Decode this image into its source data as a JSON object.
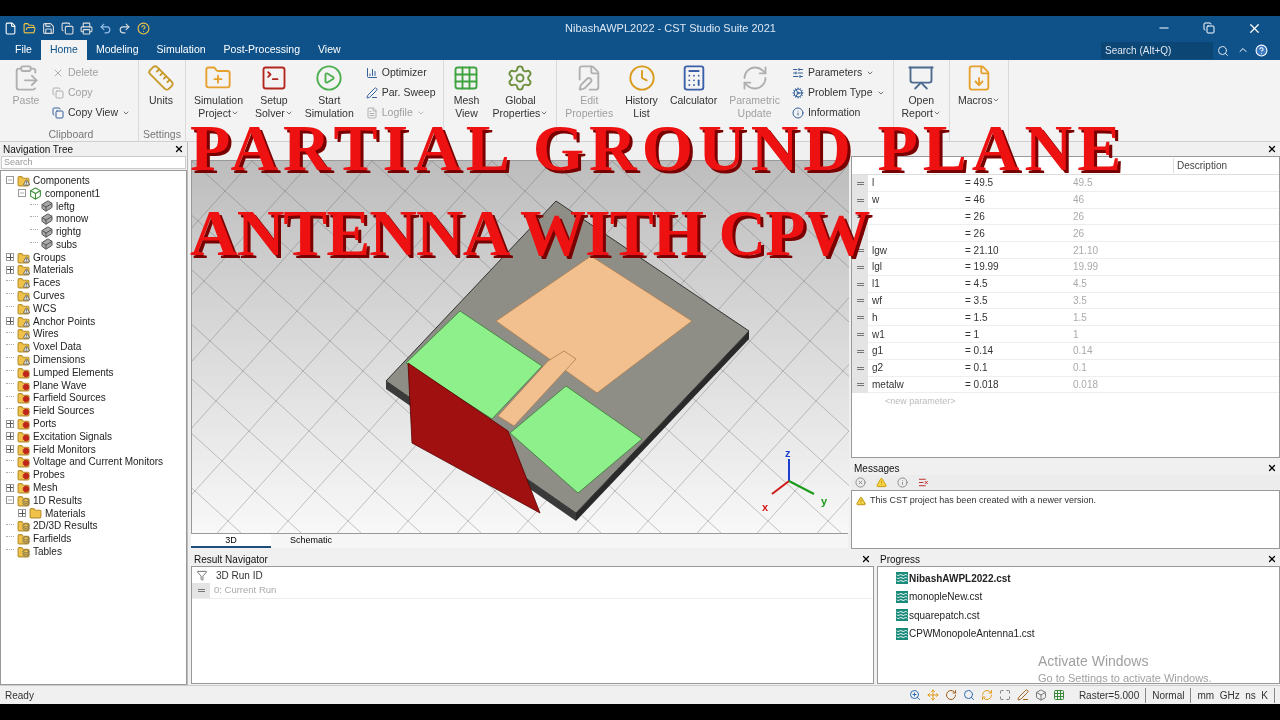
{
  "window": {
    "title": "NibashAWPL2022 - CST Studio Suite 2021"
  },
  "menu": [
    {
      "label": "File",
      "selected": false
    },
    {
      "label": "Home",
      "selected": true
    },
    {
      "label": "Modeling",
      "selected": false
    },
    {
      "label": "Simulation",
      "selected": false
    },
    {
      "label": "Post-Processing",
      "selected": false
    },
    {
      "label": "View",
      "selected": false
    }
  ],
  "search": {
    "placeholder": "Search (Alt+Q)"
  },
  "ribbon": [
    {
      "label": "Clipboard",
      "items": [
        {
          "kind": "large",
          "lines": [
            "Paste"
          ],
          "disabled": true,
          "dropdown": false
        },
        {
          "kind": "stack",
          "items": [
            {
              "label": "Delete",
              "disabled": true,
              "dropdown": false
            },
            {
              "label": "Copy",
              "disabled": true,
              "dropdown": false
            },
            {
              "label": "Copy View",
              "disabled": false,
              "dropdown": true
            }
          ]
        }
      ]
    },
    {
      "label": "Settings",
      "items": [
        {
          "kind": "large",
          "lines": [
            "Units"
          ],
          "disabled": false,
          "dropdown": false
        }
      ]
    },
    {
      "items": [
        {
          "kind": "large",
          "lines": [
            "Simulation",
            "Project"
          ],
          "disabled": false,
          "dropdown": true
        },
        {
          "kind": "large",
          "lines": [
            "Setup",
            "Solver"
          ],
          "disabled": false,
          "dropdown": true
        },
        {
          "kind": "large",
          "lines": [
            "Start",
            "Simulation"
          ],
          "disabled": false,
          "dropdown": false
        },
        {
          "kind": "stack",
          "items": [
            {
              "label": "Optimizer",
              "disabled": false,
              "dropdown": false
            },
            {
              "label": "Par. Sweep",
              "disabled": false,
              "dropdown": false
            },
            {
              "label": "Logfile",
              "disabled": true,
              "dropdown": true
            }
          ]
        }
      ]
    },
    {
      "items": [
        {
          "kind": "large",
          "lines": [
            "Mesh",
            "View"
          ],
          "disabled": false,
          "dropdown": false
        },
        {
          "kind": "large",
          "lines": [
            "Global",
            "Properties"
          ],
          "disabled": false,
          "dropdown": true
        }
      ]
    },
    {
      "items": [
        {
          "kind": "large",
          "lines": [
            "Edit",
            "Properties"
          ],
          "disabled": true,
          "dropdown": false
        },
        {
          "kind": "large",
          "lines": [
            "History",
            "List"
          ],
          "disabled": false,
          "dropdown": false
        },
        {
          "kind": "large",
          "lines": [
            "Calculator"
          ],
          "disabled": false,
          "dropdown": false
        },
        {
          "kind": "large",
          "lines": [
            "Parametric",
            "Update"
          ],
          "disabled": true,
          "dropdown": false
        },
        {
          "kind": "stack",
          "items": [
            {
              "label": "Parameters",
              "disabled": false,
              "dropdown": true
            },
            {
              "label": "Problem Type",
              "disabled": false,
              "dropdown": true
            },
            {
              "label": "Information",
              "disabled": false,
              "dropdown": false
            }
          ]
        }
      ]
    },
    {
      "items": [
        {
          "kind": "large",
          "lines": [
            "Open",
            "Report"
          ],
          "disabled": false,
          "dropdown": true
        }
      ]
    },
    {
      "items": [
        {
          "kind": "large",
          "lines": [
            "Macros"
          ],
          "disabled": false,
          "dropdown": true
        }
      ]
    }
  ],
  "navigation_tree": {
    "title": "Navigation Tree",
    "search": {
      "placeholder": "Search"
    },
    "items": [
      {
        "label": "Components",
        "kind": "folder-warn",
        "expandable": true,
        "expanded": true,
        "children": [
          {
            "label": "component1",
            "kind": "component",
            "expandable": true,
            "expanded": true,
            "children": [
              {
                "label": "leftg",
                "kind": "solid"
              },
              {
                "label": "monow",
                "kind": "solid"
              },
              {
                "label": "rightg",
                "kind": "solid"
              },
              {
                "label": "subs",
                "kind": "solid"
              }
            ]
          }
        ]
      },
      {
        "label": "Groups",
        "kind": "folder-warn",
        "expandable": true,
        "expanded": false
      },
      {
        "label": "Materials",
        "kind": "folder-warn",
        "expandable": true,
        "expanded": false
      },
      {
        "label": "Faces",
        "kind": "folder-warn",
        "expandable": false
      },
      {
        "label": "Curves",
        "kind": "folder-warn",
        "expandable": false
      },
      {
        "label": "WCS",
        "kind": "folder-warn",
        "expandable": false
      },
      {
        "label": "Anchor Points",
        "kind": "folder-warn",
        "expandable": true,
        "expanded": false
      },
      {
        "label": "Wires",
        "kind": "folder-warn",
        "expandable": false
      },
      {
        "label": "Voxel Data",
        "kind": "folder-warn",
        "expandable": false
      },
      {
        "label": "Dimensions",
        "kind": "folder-warn",
        "expandable": false
      },
      {
        "label": "Lumped Elements",
        "kind": "folder-gear",
        "expandable": false
      },
      {
        "label": "Plane Wave",
        "kind": "folder-gear",
        "expandable": false
      },
      {
        "label": "Farfield Sources",
        "kind": "folder-gear",
        "expandable": false
      },
      {
        "label": "Field Sources",
        "kind": "folder-gear",
        "expandable": false
      },
      {
        "label": "Ports",
        "kind": "folder-gear",
        "expandable": true,
        "expanded": false
      },
      {
        "label": "Excitation Signals",
        "kind": "folder-gear",
        "expandable": true,
        "expanded": false
      },
      {
        "label": "Field Monitors",
        "kind": "folder-gear",
        "expandable": true,
        "expanded": false
      },
      {
        "label": "Voltage and Current Monitors",
        "kind": "folder-gear",
        "expandable": false
      },
      {
        "label": "Probes",
        "kind": "folder-gear",
        "expandable": false
      },
      {
        "label": "Mesh",
        "kind": "folder-gear",
        "expandable": true,
        "expanded": false
      },
      {
        "label": "1D Results",
        "kind": "folder-results",
        "expandable": true,
        "expanded": true,
        "children": [
          {
            "label": "Materials",
            "kind": "folder",
            "expandable": true,
            "expanded": false
          }
        ]
      },
      {
        "label": "2D/3D Results",
        "kind": "folder-results",
        "expandable": false
      },
      {
        "label": "Farfields",
        "kind": "folder-results",
        "expandable": false
      },
      {
        "label": "Tables",
        "kind": "folder-results",
        "expandable": false
      }
    ]
  },
  "viewport": {
    "axes": {
      "x": "x",
      "y": "y",
      "z": "z"
    },
    "tabs": [
      {
        "label": "3D",
        "selected": true
      },
      {
        "label": "Schematic",
        "selected": false
      }
    ]
  },
  "parameters": {
    "columns": [
      "Description"
    ],
    "rows": [
      {
        "name": "l",
        "expression": "= 49.5",
        "value": "49.5"
      },
      {
        "name": "w",
        "expression": "= 46",
        "value": "46"
      },
      {
        "expression": "= 26",
        "value": "26"
      },
      {
        "expression": "= 26",
        "value": "26"
      },
      {
        "name": "lgw",
        "expression": "= 21.10",
        "value": "21.10"
      },
      {
        "name": "lgl",
        "expression": "= 19.99",
        "value": "19.99"
      },
      {
        "name": "l1",
        "expression": "= 4.5",
        "value": "4.5"
      },
      {
        "name": "wf",
        "expression": "= 3.5",
        "value": "3.5"
      },
      {
        "name": "h",
        "expression": "= 1.5",
        "value": "1.5"
      },
      {
        "name": "w1",
        "expression": "= 1",
        "value": "1"
      },
      {
        "name": "g1",
        "expression": "= 0.14",
        "value": "0.14"
      },
      {
        "name": "g2",
        "expression": "= 0.1",
        "value": "0.1"
      },
      {
        "name": "metalw",
        "expression": "= 0.018",
        "value": "0.018"
      }
    ],
    "new_row_placeholder": "<new parameter>"
  },
  "messages": {
    "title": "Messages",
    "items": [
      {
        "text": "This CST project has been created with a newer version.",
        "kind": "warning"
      }
    ]
  },
  "result_navigator": {
    "title": "Result Navigator",
    "column": "3D Run ID",
    "rows": [
      "0: Current Run"
    ]
  },
  "progress": {
    "title": "Progress",
    "items": [
      {
        "label": "NibashAWPL2022.cst",
        "active": true
      },
      {
        "label": "monopleNew.cst",
        "active": false
      },
      {
        "label": "squarepatch.cst",
        "active": false
      },
      {
        "label": "CPWMonopoleAntenna1.cst",
        "active": false
      }
    ]
  },
  "activation_notice": {
    "title": "Activate Windows",
    "text": "Go to Settings to activate Windows."
  },
  "status_bar": {
    "status": "Ready",
    "raster": "Raster=5.000",
    "mode": "Normal",
    "units": "mm  GHz  ns  K"
  },
  "overlay_title": [
    "PARTIAL GROUND PLANE",
    "ANTENNA WITH CPW"
  ]
}
